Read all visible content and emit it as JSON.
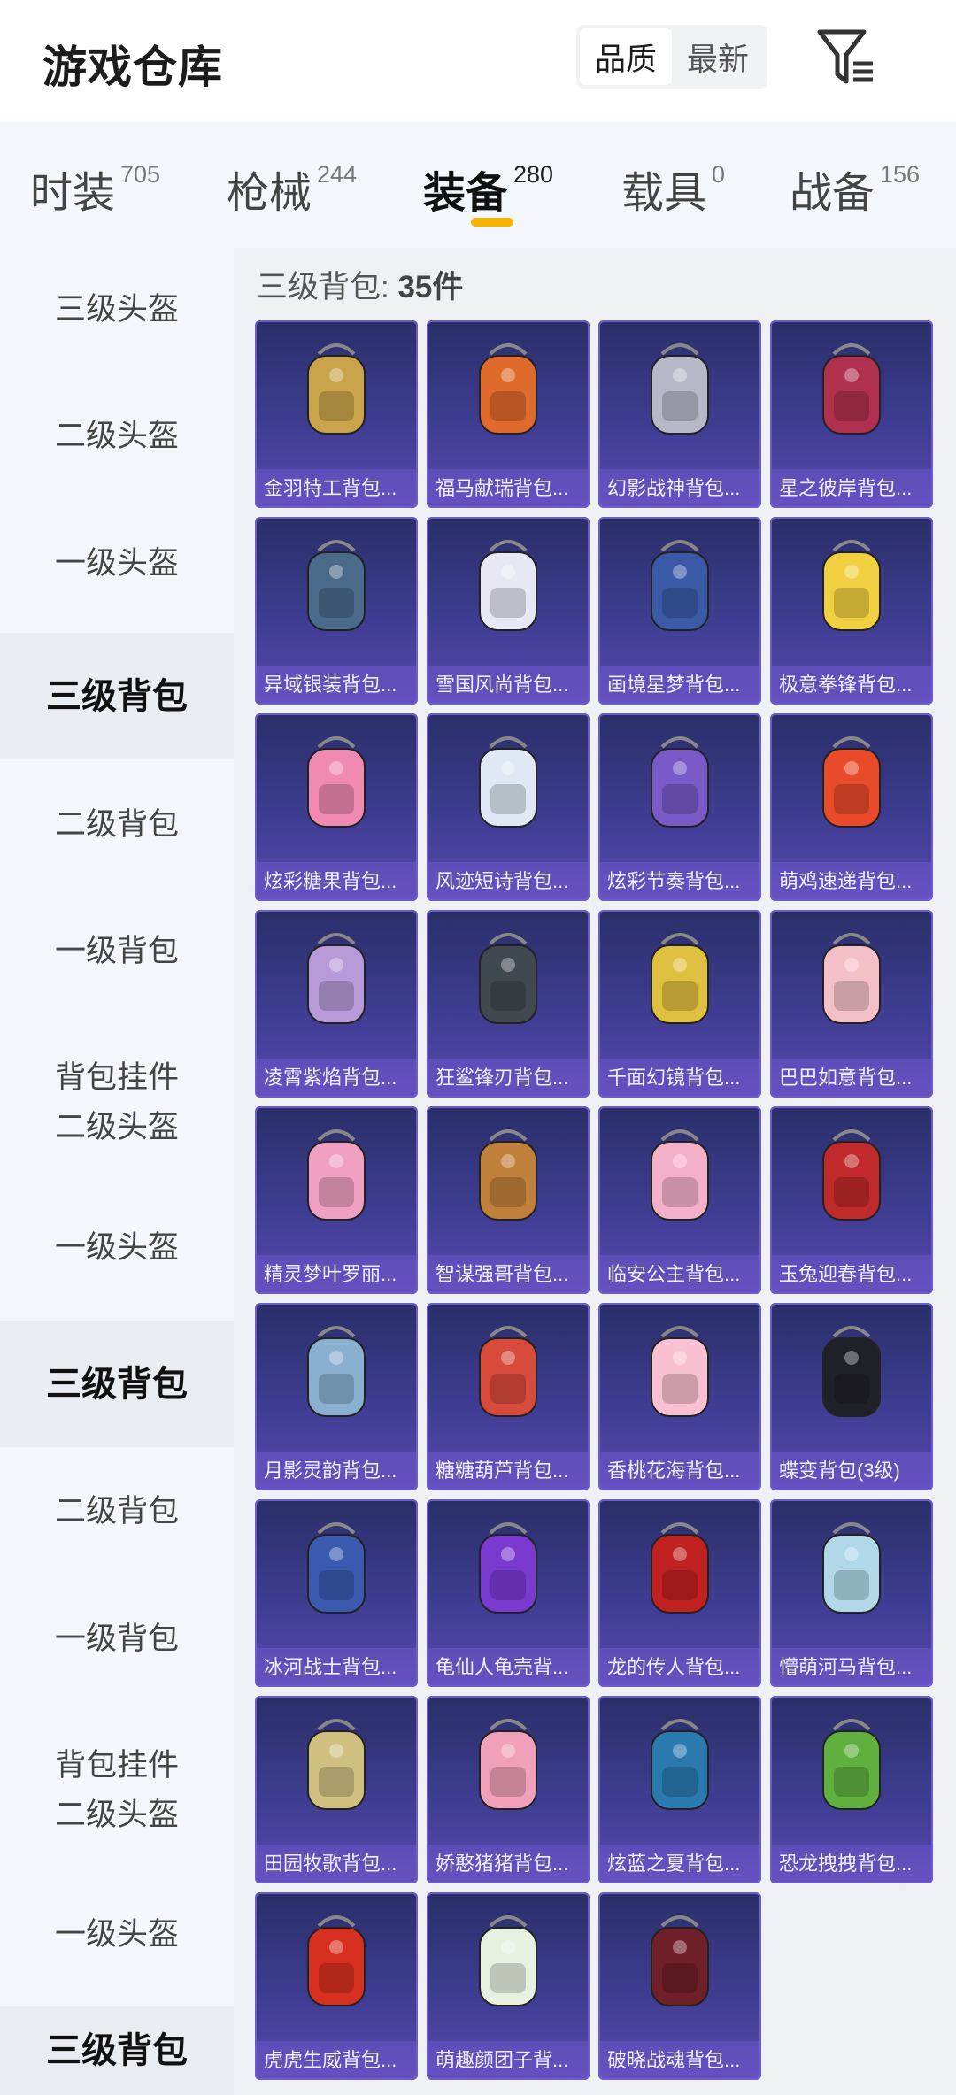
{
  "header": {
    "title": "游戏仓库",
    "sort_options": [
      "品质",
      "最新"
    ],
    "sort_active": "品质",
    "filter_icon": "filter-icon"
  },
  "tabs": [
    {
      "label": "时装",
      "count": "705"
    },
    {
      "label": "枪械",
      "count": "244"
    },
    {
      "label": "装备",
      "count": "280",
      "active": true
    },
    {
      "label": "载具",
      "count": "0"
    },
    {
      "label": "战备",
      "count": "156"
    }
  ],
  "sidebar": {
    "items": [
      "三级头盔",
      "二级头盔",
      "一级头盔",
      "三级背包",
      "二级背包",
      "一级背包",
      "背包挂件",
      "二级头盔",
      "一级头盔",
      "三级背包",
      "二级背包",
      "一级背包",
      "背包挂件",
      "二级头盔",
      "一级头盔",
      "三级背包"
    ],
    "active_label": "三级背包"
  },
  "content": {
    "category": "三级背包",
    "count": "35件",
    "items": [
      "金羽特工背包...",
      "福马献瑞背包...",
      "幻影战神背包...",
      "星之彼岸背包...",
      "异域银装背包...",
      "雪国风尚背包...",
      "画境星梦背包...",
      "极意拳锋背包...",
      "炫彩糖果背包...",
      "风迹短诗背包...",
      "炫彩节奏背包...",
      "萌鸡速递背包...",
      "凌霄紫焰背包...",
      "狂鲨锋刃背包...",
      "千面幻镜背包...",
      "巴巴如意背包...",
      "精灵梦叶罗丽...",
      "智谋强哥背包...",
      "临安公主背包...",
      "玉兔迎春背包...",
      "月影灵韵背包...",
      "糖糖葫芦背包...",
      "香桃花海背包...",
      "蝶变背包(3级)",
      "冰河战士背包...",
      "龟仙人龟壳背...",
      "龙的传人背包...",
      "懵萌河马背包...",
      "田园牧歌背包...",
      "娇憨猪猪背包...",
      "炫蓝之夏背包...",
      "恐龙拽拽背包...",
      "虎虎生威背包...",
      "萌趣颜团子背...",
      "破晓战魂背包..."
    ]
  },
  "colors": {
    "accent": "#f6b200",
    "card_top": "#2a2e68",
    "card_bottom": "#5a49b0",
    "sidebar_bg": "#f3f7fb",
    "content_bg": "#eef0f3"
  }
}
